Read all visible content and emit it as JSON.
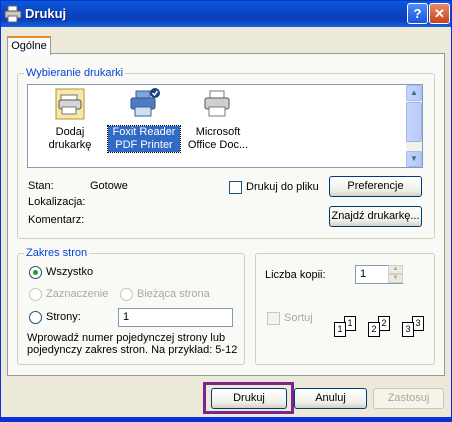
{
  "window": {
    "title": "Drukuj"
  },
  "tabs": [
    {
      "label": "Ogólne"
    }
  ],
  "printer_group": {
    "legend": "Wybieranie drukarki",
    "printers": [
      {
        "label_line1": "Dodaj",
        "label_line2": "drukarkę",
        "icon": "add-printer-icon"
      },
      {
        "label_line1": "Foxit Reader",
        "label_line2": "PDF Printer",
        "icon": "printer-icon",
        "selected": true
      },
      {
        "label_line1": "Microsoft",
        "label_line2": "Office Doc...",
        "icon": "printer-icon"
      }
    ],
    "status_label": "Stan:",
    "status_value": "Gotowe",
    "location_label": "Lokalizacja:",
    "comment_label": "Komentarz:",
    "print_to_file_label": "Drukuj do pliku",
    "preferences_button": "Preferencje",
    "find_printer_button": "Znajdź drukarkę..."
  },
  "range_group": {
    "legend": "Zakres stron",
    "all_label": "Wszystko",
    "selection_label": "Zaznaczenie",
    "current_page_label": "Bieżąca strona",
    "pages_label": "Strony:",
    "pages_value": "1",
    "hint": "Wprowadź numer pojedynczej strony lub pojedynczy zakres stron. Na przykład: 5-12"
  },
  "copies": {
    "label": "Liczba kopii:",
    "value": "1",
    "collate_label": "Sortuj",
    "collate_pages": [
      "1",
      "1",
      "2",
      "2",
      "3",
      "3"
    ]
  },
  "buttons": {
    "print": "Drukuj",
    "cancel": "Anuluj",
    "apply": "Zastosuj"
  },
  "colors": {
    "title_bar": "#0a47c8",
    "legend": "#0046d5",
    "selection": "#316ac5",
    "highlight": "#7b2690"
  }
}
